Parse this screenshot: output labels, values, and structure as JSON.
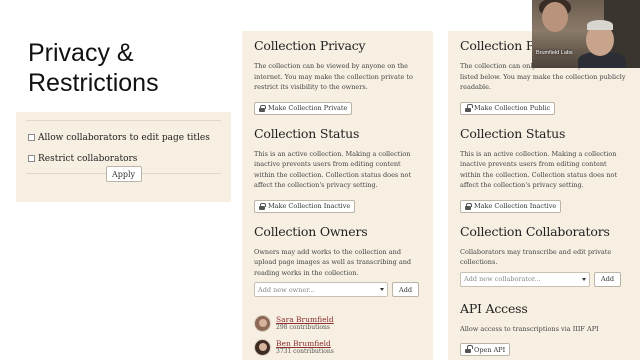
{
  "slide": {
    "title": "Privacy & Restrictions"
  },
  "settings": {
    "checkbox_allow_titles": "Allow collaborators to edit page titles",
    "checkbox_restrict": "Restrict collaborators",
    "apply_label": "Apply"
  },
  "left_panel": {
    "privacy": {
      "heading": "Collection Privacy",
      "text": "The collection can be viewed by anyone on the internet. You may make the collection private to restrict its visibility to the owners.",
      "button": "Make Collection Private"
    },
    "status": {
      "heading": "Collection Status",
      "text": "This is an active collection. Making a collection inactive prevents users from editing content within the collection. Collection status does not affect the collection's privacy setting.",
      "button": "Make Collection Inactive"
    },
    "owners": {
      "heading": "Collection Owners",
      "text": "Owners may add works to the collection and upload page images as well as transcribing and reading works in the collection.",
      "placeholder": "Add new owner...",
      "add_label": "Add",
      "list": [
        {
          "name": "Sara Brumfield",
          "meta": "298 contributions"
        },
        {
          "name": "Ben Brumfield",
          "meta": "3731 contributions"
        }
      ]
    }
  },
  "right_panel": {
    "privacy": {
      "heading": "Collection Privacy",
      "text": "The collection can only be viewed by the owners listed below. You may make the collection publicly readable.",
      "button": "Make Collection Public"
    },
    "status": {
      "heading": "Collection Status",
      "text": "This is an active collection. Making a collection inactive prevents users from editing content within the collection. Collection status does not affect the collection's privacy setting.",
      "button": "Make Collection Inactive"
    },
    "collaborators": {
      "heading": "Collection Collaborators",
      "text": "Collaborators may transcribe and edit private collections.",
      "placeholder": "Add new collaborator...",
      "add_label": "Add"
    },
    "api": {
      "heading": "API Access",
      "text": "Allow access to transcriptions via IIIF API",
      "button": "Open API"
    }
  },
  "video": {
    "label": "Brumfield Labs"
  }
}
